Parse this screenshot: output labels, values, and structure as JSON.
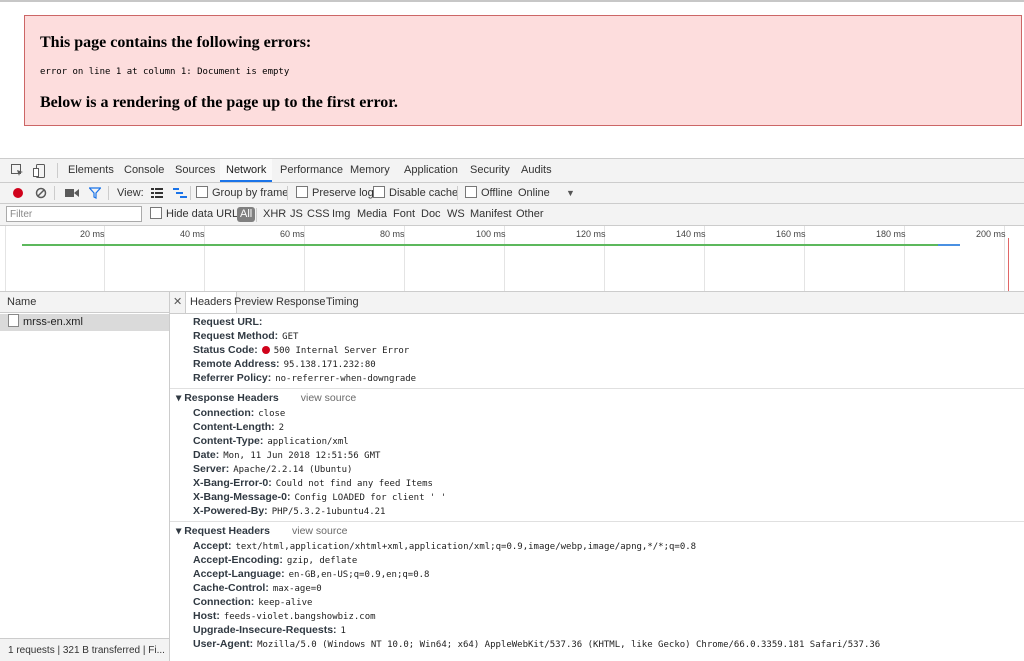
{
  "error_page": {
    "heading": "This page contains the following errors:",
    "message": "error on line 1 at column 1: Document is empty",
    "subheading": "Below is a rendering of the page up to the first error."
  },
  "devtools": {
    "tabs": [
      "Elements",
      "Console",
      "Sources",
      "Network",
      "Performance",
      "Memory",
      "Application",
      "Security",
      "Audits"
    ],
    "active_tab": "Network",
    "toolbar": {
      "view_label": "View:",
      "group_by_frame": "Group by frame",
      "preserve_log": "Preserve log",
      "disable_cache": "Disable cache",
      "offline": "Offline",
      "throttle": "Online"
    },
    "filter": {
      "placeholder": "Filter",
      "hide_data_urls": "Hide data URLs",
      "types": [
        "All",
        "XHR",
        "JS",
        "CSS",
        "Img",
        "Media",
        "Font",
        "Doc",
        "WS",
        "Manifest",
        "Other"
      ]
    },
    "timeline_ticks": [
      "20 ms",
      "40 ms",
      "60 ms",
      "80 ms",
      "100 ms",
      "120 ms",
      "140 ms",
      "160 ms",
      "180 ms",
      "200 ms"
    ],
    "requests": {
      "column_name": "Name",
      "items": [
        "mrss-en.xml"
      ],
      "status_bar": "1 requests | 321 B transferred | Fi..."
    },
    "detail_tabs": [
      "Headers",
      "Preview",
      "Response",
      "Timing"
    ],
    "general": [
      {
        "k": "Request URL:",
        "v": ""
      },
      {
        "k": "Request Method:",
        "v": "GET"
      },
      {
        "k": "Status Code:",
        "v": "500 Internal Server Error"
      },
      {
        "k": "Remote Address:",
        "v": "95.138.171.232:80"
      },
      {
        "k": "Referrer Policy:",
        "v": "no-referrer-when-downgrade"
      }
    ],
    "response_headers": {
      "title": "Response Headers",
      "view_source": "view source",
      "items": [
        {
          "k": "Connection:",
          "v": "close"
        },
        {
          "k": "Content-Length:",
          "v": "2"
        },
        {
          "k": "Content-Type:",
          "v": "application/xml"
        },
        {
          "k": "Date:",
          "v": "Mon, 11 Jun 2018 12:51:56 GMT"
        },
        {
          "k": "Server:",
          "v": "Apache/2.2.14 (Ubuntu)"
        },
        {
          "k": "X-Bang-Error-0:",
          "v": "Could not find any feed Items"
        },
        {
          "k": "X-Bang-Message-0:",
          "v": "Config LOADED for client '              '"
        },
        {
          "k": "X-Powered-By:",
          "v": "PHP/5.3.2-1ubuntu4.21"
        }
      ]
    },
    "request_headers": {
      "title": "Request Headers",
      "view_source": "view source",
      "items": [
        {
          "k": "Accept:",
          "v": "text/html,application/xhtml+xml,application/xml;q=0.9,image/webp,image/apng,*/*;q=0.8"
        },
        {
          "k": "Accept-Encoding:",
          "v": "gzip, deflate"
        },
        {
          "k": "Accept-Language:",
          "v": "en-GB,en-US;q=0.9,en;q=0.8"
        },
        {
          "k": "Cache-Control:",
          "v": "max-age=0"
        },
        {
          "k": "Connection:",
          "v": "keep-alive"
        },
        {
          "k": "Host:",
          "v": "feeds-violet.bangshowbiz.com"
        },
        {
          "k": "Upgrade-Insecure-Requests:",
          "v": "1"
        },
        {
          "k": "User-Agent:",
          "v": "Mozilla/5.0 (Windows NT 10.0; Win64; x64) AppleWebKit/537.36 (KHTML, like Gecko) Chrome/66.0.3359.181 Safari/537.36"
        }
      ]
    },
    "colors": {
      "error_bg": "#fddddd",
      "status_error": "#d0021b",
      "active_tab": "#1a73e8"
    }
  }
}
